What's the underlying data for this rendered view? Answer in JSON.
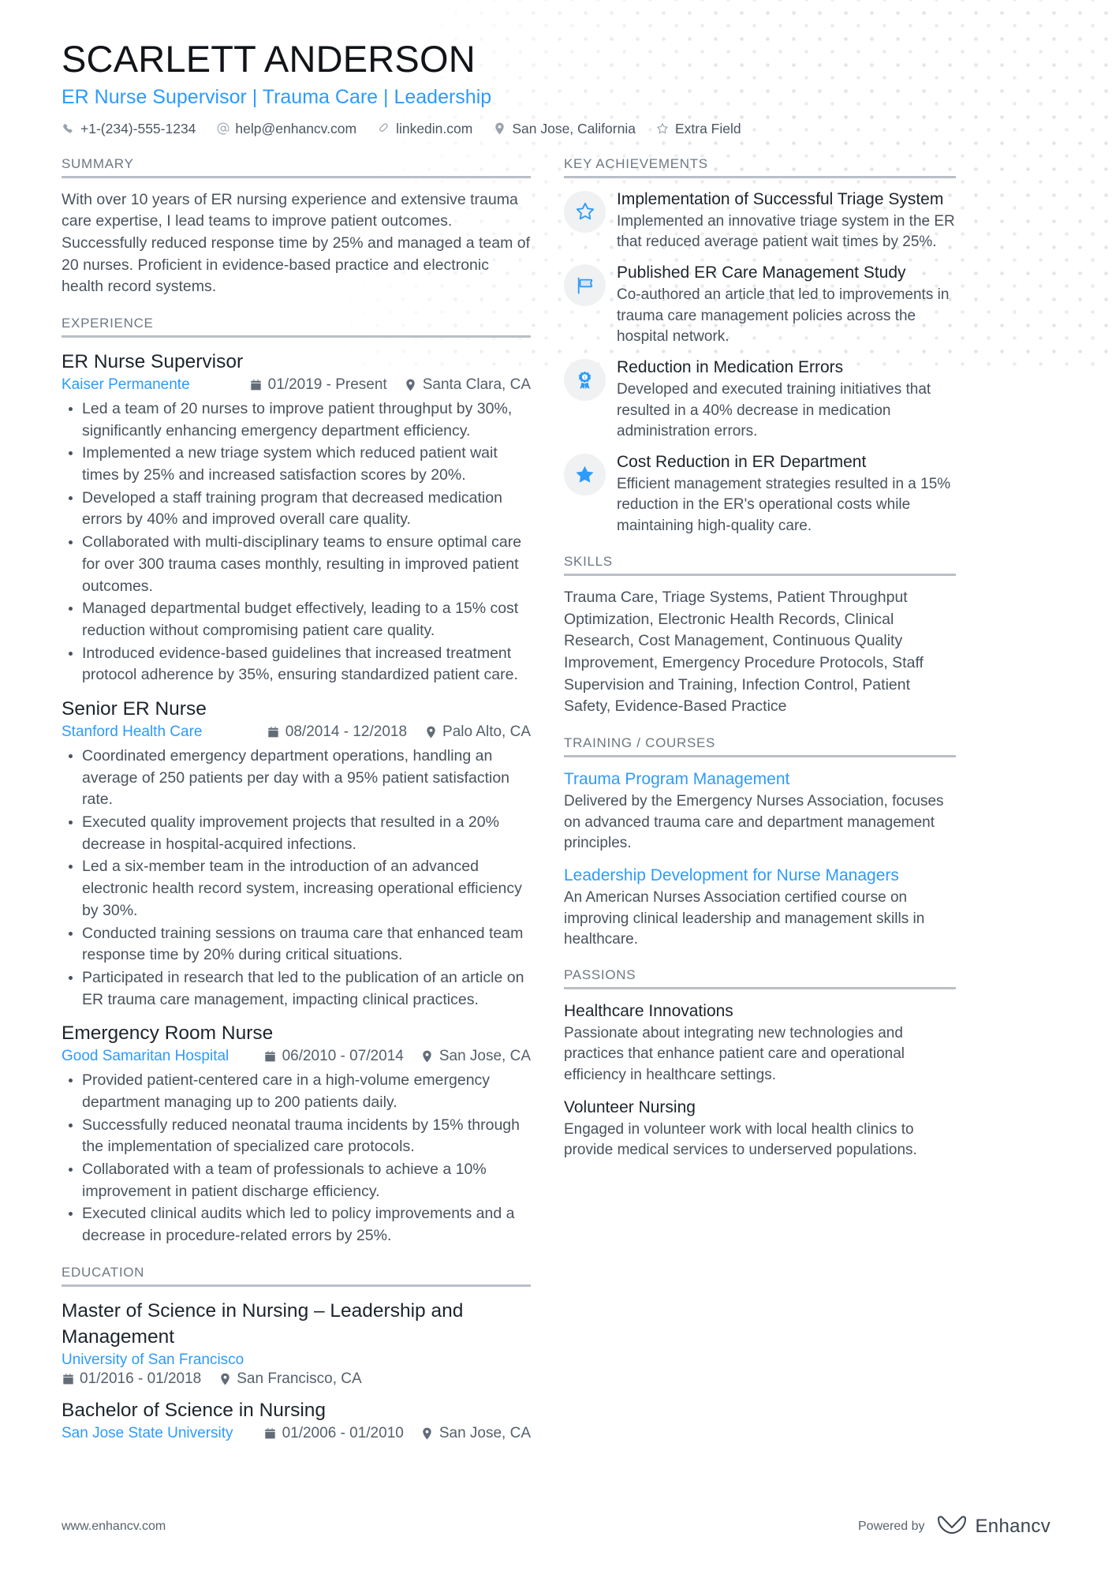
{
  "header": {
    "name": "SCARLETT ANDERSON",
    "title": "ER Nurse Supervisor | Trauma Care | Leadership",
    "accent_color": "#2d9bfb",
    "contacts": [
      {
        "icon": "phone-icon",
        "text": "+1-(234)-555-1234"
      },
      {
        "icon": "at-icon",
        "text": "help@enhancv.com"
      },
      {
        "icon": "link-icon",
        "text": "linkedin.com"
      },
      {
        "icon": "location-icon",
        "text": "San Jose, California"
      },
      {
        "icon": "star-icon",
        "text": "Extra Field"
      }
    ]
  },
  "left": {
    "summary": {
      "heading": "SUMMARY",
      "text": "With over 10 years of ER nursing experience and extensive trauma care expertise, I lead teams to improve patient outcomes. Successfully reduced response time by 25% and managed a team of 20 nurses. Proficient in evidence-based practice and electronic health record systems."
    },
    "experience": {
      "heading": "EXPERIENCE",
      "entries": [
        {
          "title": "ER Nurse Supervisor",
          "org": "Kaiser Permanente",
          "dates": "01/2019 - Present",
          "location": "Santa Clara, CA",
          "bullets": [
            "Led a team of 20 nurses to improve patient throughput by 30%, significantly enhancing emergency department efficiency.",
            "Implemented a new triage system which reduced patient wait times by 25% and increased satisfaction scores by 20%.",
            "Developed a staff training program that decreased medication errors by 40% and improved overall care quality.",
            "Collaborated with multi-disciplinary teams to ensure optimal care for over 300 trauma cases monthly, resulting in improved patient outcomes.",
            "Managed departmental budget effectively, leading to a 15% cost reduction without compromising patient care quality.",
            "Introduced evidence-based guidelines that increased treatment protocol adherence by 35%, ensuring standardized patient care."
          ]
        },
        {
          "title": "Senior ER Nurse",
          "org": "Stanford Health Care",
          "dates": "08/2014 - 12/2018",
          "location": "Palo Alto, CA",
          "bullets": [
            "Coordinated emergency department operations, handling an average of 250 patients per day with a 95% patient satisfaction rate.",
            "Executed quality improvement projects that resulted in a 20% decrease in hospital-acquired infections.",
            "Led a six-member team in the introduction of an advanced electronic health record system, increasing operational efficiency by 30%.",
            "Conducted training sessions on trauma care that enhanced team response time by 20% during critical situations.",
            "Participated in research that led to the publication of an article on ER trauma care management, impacting clinical practices."
          ]
        },
        {
          "title": "Emergency Room Nurse",
          "org": "Good Samaritan Hospital",
          "dates": "06/2010 - 07/2014",
          "location": "San Jose, CA",
          "bullets": [
            "Provided patient-centered care in a high-volume emergency department managing up to 200 patients daily.",
            "Successfully reduced neonatal trauma incidents by 15% through the implementation of specialized care protocols.",
            "Collaborated with a team of professionals to achieve a 10% improvement in patient discharge efficiency.",
            "Executed clinical audits which led to policy improvements and a decrease in procedure-related errors by 25%."
          ]
        }
      ]
    },
    "education": {
      "heading": "EDUCATION",
      "entries": [
        {
          "title": "Master of Science in Nursing – Leadership and Management",
          "org": "University of San Francisco",
          "dates": "01/2016 - 01/2018",
          "location": "San Francisco, CA",
          "meta_inline": false
        },
        {
          "title": "Bachelor of Science in Nursing",
          "org": "San Jose State University",
          "dates": "01/2006 - 01/2010",
          "location": "San Jose, CA",
          "meta_inline": true
        }
      ]
    }
  },
  "right": {
    "achievements": {
      "heading": "KEY ACHIEVEMENTS",
      "items": [
        {
          "icon": "star-outline-icon",
          "title": "Implementation of Successful Triage System",
          "desc": "Implemented an innovative triage system in the ER that reduced average patient wait times by 25%."
        },
        {
          "icon": "flag-icon",
          "title": "Published ER Care Management Study",
          "desc": "Co-authored an article that led to improvements in trauma care management policies across the hospital network."
        },
        {
          "icon": "award-icon",
          "title": "Reduction in Medication Errors",
          "desc": "Developed and executed training initiatives that resulted in a 40% decrease in medication administration errors."
        },
        {
          "icon": "star-filled-icon",
          "title": "Cost Reduction in ER Department",
          "desc": "Efficient management strategies resulted in a 15% reduction in the ER's operational costs while maintaining high-quality care."
        }
      ]
    },
    "skills": {
      "heading": "SKILLS",
      "text": "Trauma Care, Triage Systems, Patient Throughput Optimization, Electronic Health Records, Clinical Research, Cost Management, Continuous Quality Improvement, Emergency Procedure Protocols, Staff Supervision and Training, Infection Control, Patient Safety, Evidence-Based Practice"
    },
    "training": {
      "heading": "TRAINING / COURSES",
      "items": [
        {
          "title": "Trauma Program Management",
          "desc": "Delivered by the Emergency Nurses Association, focuses on advanced trauma care and department management principles."
        },
        {
          "title": "Leadership Development for Nurse Managers",
          "desc": "An American Nurses Association certified course on improving clinical leadership and management skills in healthcare."
        }
      ]
    },
    "passions": {
      "heading": "PASSIONS",
      "items": [
        {
          "title": "Healthcare Innovations",
          "desc": "Passionate about integrating new technologies and practices that enhance patient care and operational efficiency in healthcare settings."
        },
        {
          "title": "Volunteer Nursing",
          "desc": "Engaged in volunteer work with local health clinics to provide medical services to underserved populations."
        }
      ]
    }
  },
  "footer": {
    "url": "www.enhancv.com",
    "powered_by": "Powered by",
    "brand": "Enhancv"
  }
}
